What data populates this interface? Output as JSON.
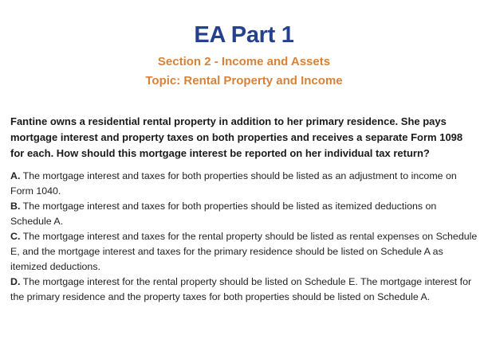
{
  "header": {
    "title": "EA Part 1",
    "section": "Section 2 - Income and Assets",
    "topic": "Topic: Rental Property and Income"
  },
  "question": {
    "text": "Fantine owns a residential rental property in addition to her primary residence. She pays mortgage interest and property taxes on both properties and receives a separate Form 1098 for each. How should this mortgage interest be reported on her individual tax return?"
  },
  "answers": [
    {
      "letter": "A.",
      "text": "The mortgage interest and taxes for both properties should be listed as an adjustment to income on Form 1040."
    },
    {
      "letter": "B.",
      "text": "The mortgage interest and taxes for both properties should be listed as itemized deductions on Schedule A."
    },
    {
      "letter": "C.",
      "text": "The mortgage interest and taxes for the rental property should be listed as rental expenses on Schedule E, and the mortgage interest and taxes for the primary residence should be listed on Schedule A as itemized deductions."
    },
    {
      "letter": "D.",
      "text": "The mortgage interest for the rental property should be listed on Schedule E. The mortgage interest for the primary residence and the property taxes for both properties should be listed on Schedule A."
    }
  ]
}
